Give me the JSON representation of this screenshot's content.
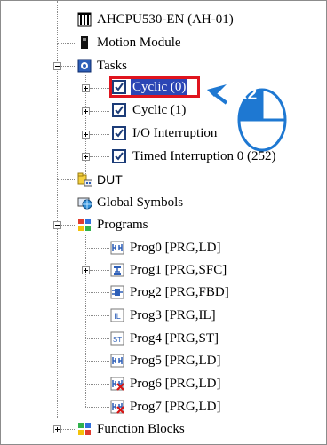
{
  "tree": {
    "cpu": {
      "label": "AHCPU530-EN  (AH-01)",
      "icon": "cpu-icon"
    },
    "motion": {
      "label": "Motion Module",
      "icon": "motion-module-icon"
    },
    "tasks": {
      "label": "Tasks",
      "icon": "tasks-gear-icon",
      "expanded": true
    },
    "task_items": [
      {
        "label": "Cyclic (0)",
        "checked": true,
        "selected": true
      },
      {
        "label": "Cyclic (1)",
        "checked": true
      },
      {
        "label": "I/O Interruption",
        "checked": true
      },
      {
        "label": "Timed Interruption 0 (252)",
        "checked": true
      }
    ],
    "dut": {
      "label": "DUT",
      "icon": "dut-folder-icon"
    },
    "global_symbols": {
      "label": "Global Symbols",
      "icon": "global-symbols-icon"
    },
    "programs": {
      "label": "Programs",
      "icon": "programs-icon",
      "expanded": true
    },
    "program_items": [
      {
        "label": "Prog0 [PRG,LD]",
        "icon": "ld-program-icon"
      },
      {
        "label": "Prog1 [PRG,SFC]",
        "icon": "sfc-program-icon"
      },
      {
        "label": "Prog2 [PRG,FBD]",
        "icon": "fbd-program-icon"
      },
      {
        "label": "Prog3 [PRG,IL]",
        "icon": "il-program-icon"
      },
      {
        "label": "Prog4 [PRG,ST]",
        "icon": "st-program-icon"
      },
      {
        "label": "Prog5 [PRG,LD]",
        "icon": "ld-program-icon"
      },
      {
        "label": "Prog6 [PRG,LD]",
        "icon": "ld-program-disabled-icon"
      },
      {
        "label": "Prog7 [PRG,LD]",
        "icon": "ld-program-disabled-icon"
      }
    ],
    "function_blocks": {
      "label": "Function Blocks",
      "icon": "function-blocks-icon"
    }
  },
  "callout": {
    "text": "x2",
    "icon": "mouse-double-click-icon"
  },
  "colors": {
    "highlight_box": "#e0141e",
    "selection_bg": "#2b46b5",
    "callout_blue": "#1e78d2"
  }
}
